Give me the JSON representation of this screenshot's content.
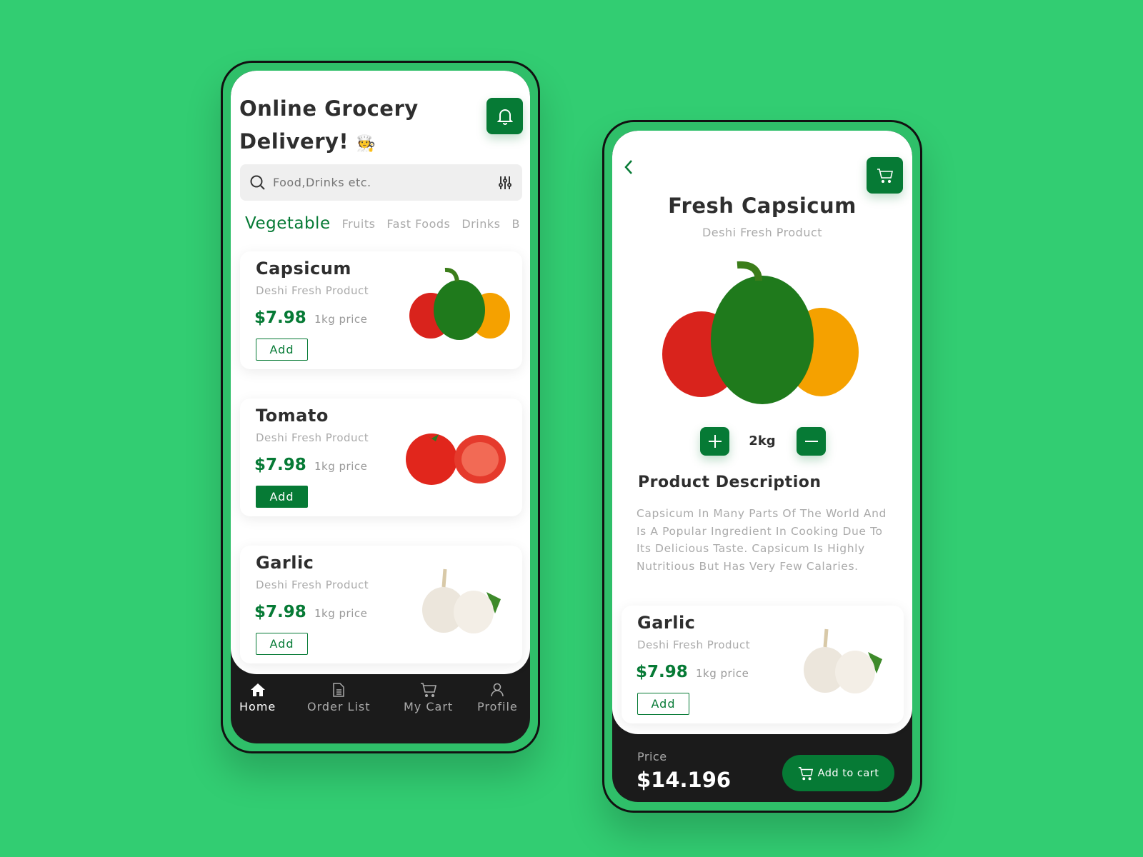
{
  "colors": {
    "background": "#32cd72",
    "accent": "#067a35",
    "dark": "#1b1b1b"
  },
  "home": {
    "title_line1": "Online Grocery",
    "title_line2": "Delivery!",
    "title_emoji": "🧑‍🍳",
    "notification_icon": "bell-icon",
    "search": {
      "placeholder": "Food,Drinks etc.",
      "icon": "search-icon",
      "filter_icon": "sliders-icon"
    },
    "categories": [
      "Vegetable",
      "Fruits",
      "Fast Foods",
      "Drinks",
      "B"
    ],
    "products": [
      {
        "name": "Capsicum",
        "subtitle": "Deshi Fresh Product",
        "price": "$7.98",
        "unit": "1kg price",
        "button": "Add",
        "selected": false
      },
      {
        "name": "Tomato",
        "subtitle": "Deshi Fresh Product",
        "price": "$7.98",
        "unit": "1kg price",
        "button": "Add",
        "selected": true
      },
      {
        "name": "Garlic",
        "subtitle": "Deshi Fresh Product",
        "price": "$7.98",
        "unit": "1kg price",
        "button": "Add",
        "selected": false
      }
    ],
    "nav": [
      {
        "label": "Home",
        "icon": "home-icon"
      },
      {
        "label": "Order List",
        "icon": "document-icon"
      },
      {
        "label": "My Cart",
        "icon": "cart-icon"
      },
      {
        "label": "Profile",
        "icon": "user-icon"
      }
    ]
  },
  "detail": {
    "title": "Fresh Capsicum",
    "subtitle": "Deshi Fresh Product",
    "quantity": "2kg",
    "desc_heading": "Product Description",
    "description": "Capsicum In Many Parts Of The World And Is A Popular Ingredient In Cooking Due To Its Delicious Taste. Capsicum Is Highly Nutritious But Has Very Few Calaries.",
    "related": {
      "name": "Garlic",
      "subtitle": "Deshi Fresh Product",
      "price": "$7.98",
      "unit": "1kg price",
      "button": "Add"
    },
    "price_label": "Price",
    "price": "$14.196",
    "cart_button": "Add to cart"
  }
}
